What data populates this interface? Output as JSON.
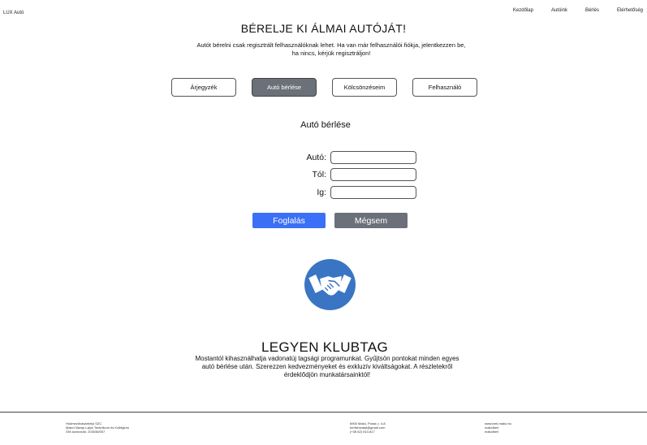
{
  "header": {
    "brand": "LUX Autó",
    "nav": [
      "Kezdőlap",
      "Autóink",
      "Bérlés",
      "Elérhetőség"
    ]
  },
  "hero": {
    "title": "BÉRELJE KI ÁLMAI AUTÓJÁT!",
    "text": "Autót bérelni csak regisztrált felhasználóknak lehet. Ha van már felhasználói fiókja, jelentkezzen be, ha nincs, kérjük regisztráljon!"
  },
  "tabs": [
    "Árjegyzék",
    "Autó bérlése",
    "Kölcsönzéseim",
    "Felhasználó"
  ],
  "active_tab": 1,
  "form": {
    "title": "Autó bérlése",
    "fields": [
      {
        "label": "Autó:",
        "value": ""
      },
      {
        "label": "Tól:",
        "value": ""
      },
      {
        "label": "Ig:",
        "value": ""
      }
    ],
    "submit_label": "Foglalás",
    "cancel_label": "Mégsem"
  },
  "club": {
    "icon": "handshake-icon",
    "title": "LEGYEN KLUBTAG",
    "text": "Mostantól kihasználhatja vadonatúj tagsági programunkat. Gyűjtsön pontokat minden egyes autó bérlése után. Szerezzen kedvezményeket és exkluzív kiváltságokat. A részletekről érdeklődjön munkatársainktól!"
  },
  "footer": {
    "col1": [
      "Hódmezővásárhelyi SZC",
      "Makói Návay Lajos Technikum és Kollégium",
      "OM azonosító: 203038/007"
    ],
    "col2": [
      "6900 Makó, Posta u. 4-8",
      "berlishivatal@gmail.com",
      "(+36 62) 510-817"
    ],
    "col3": [
      "www.berl-mako.hu",
      "makóiberl",
      "makóiberl"
    ]
  },
  "colors": {
    "primary_button": "#3b6ff5",
    "secondary_button": "#6b7079",
    "logo_circle": "#3a75c4"
  }
}
